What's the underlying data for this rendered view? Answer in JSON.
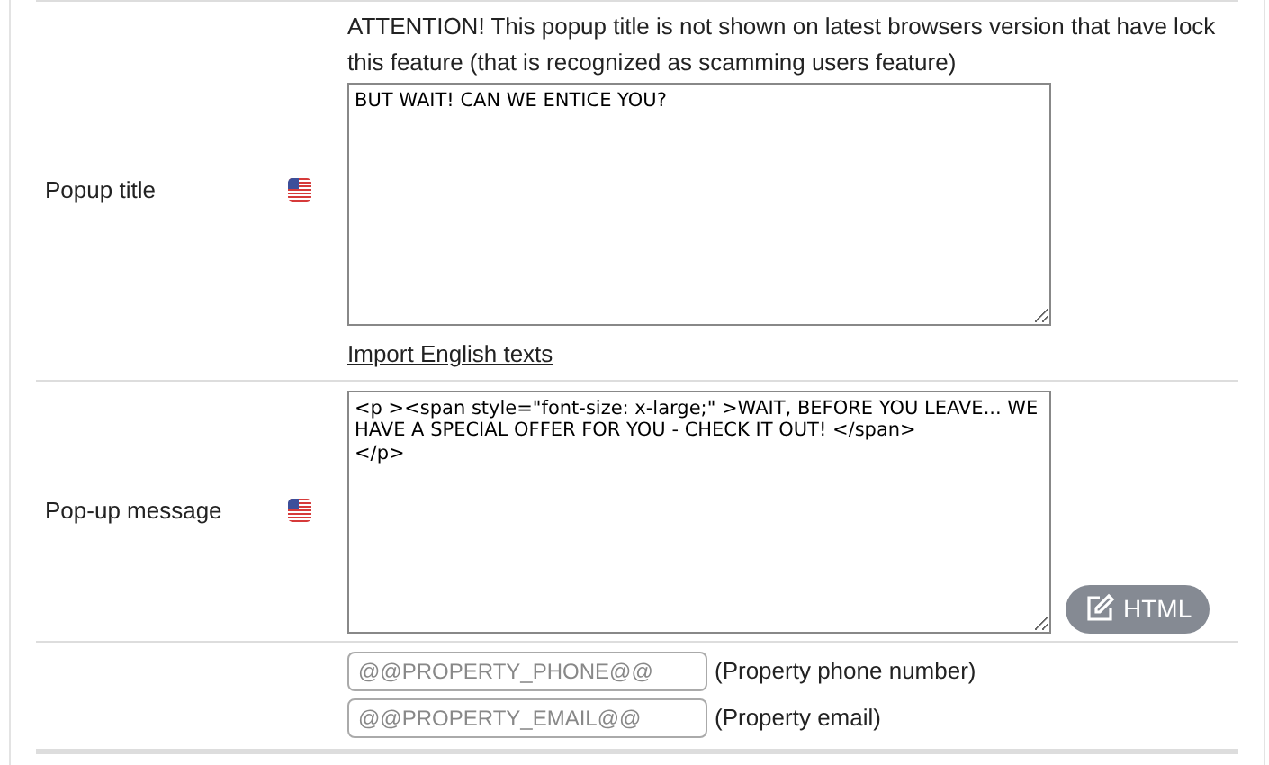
{
  "rows": [
    {
      "kind": "textarea",
      "label": "Popup title",
      "note": "ATTENTION! This popup title is not shown on latest browsers version that have lock this feature (that is recognized as scamming users feature)",
      "value": "BUT WAIT! CAN WE ENTICE YOU?",
      "link": "Import English texts"
    },
    {
      "kind": "textarea",
      "label": "Pop-up message",
      "value": "<p ><span style=\"font-size: x-large;\" >WAIT, BEFORE YOU LEAVE... WE HAVE A SPECIAL OFFER FOR YOU - CHECK IT OUT! </span>\n</p>",
      "button": "HTML"
    },
    {
      "kind": "fields",
      "fields": [
        {
          "placeholder": "@@PROPERTY_PHONE@@",
          "caption": "(Property phone number)"
        },
        {
          "placeholder": "@@PROPERTY_EMAIL@@",
          "caption": "(Property email)"
        }
      ]
    }
  ]
}
